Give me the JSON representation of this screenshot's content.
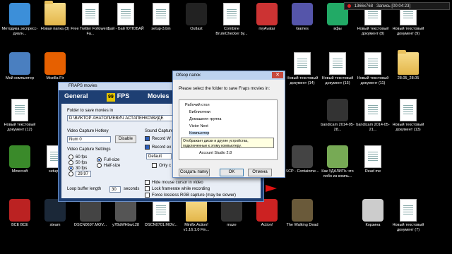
{
  "recorder": {
    "fps": "1366x768",
    "status": "Запись [00:04:23]"
  },
  "desktop_icons": [
    {
      "label": "Методика экспресс-диагн...",
      "kind": "app",
      "color": "#3c8fd9"
    },
    {
      "label": "Новая папка (3)",
      "kind": "folder"
    },
    {
      "label": "Free Twitter Followers, Fa...",
      "kind": "doc"
    },
    {
      "label": "Бай - Бай ЮТЮБАЙ",
      "kind": "doc"
    },
    {
      "label": "setup-3.bin",
      "kind": "doc"
    },
    {
      "label": "Outlast",
      "kind": "app",
      "color": "#222"
    },
    {
      "label": "Combine BruteChecker by...",
      "kind": "doc"
    },
    {
      "label": "myAvatar",
      "kind": "app",
      "color": "#c33"
    },
    {
      "label": "Games",
      "kind": "app",
      "color": "#55a"
    },
    {
      "label": "вфы",
      "kind": "app",
      "color": "#2a6"
    },
    {
      "label": "Новый текстовый документ (8)",
      "kind": "doc"
    },
    {
      "label": "Новый текстовый документ (9)",
      "kind": "doc"
    },
    {
      "label": "Мой компьютер",
      "kind": "app",
      "color": "#4a7fc0"
    },
    {
      "label": "Mozilla Fir",
      "kind": "app",
      "color": "#e66000"
    },
    {
      "label": "Новый текстовый документ (14)",
      "kind": "doc"
    },
    {
      "label": "Новый текстовый документ (15)",
      "kind": "doc"
    },
    {
      "label": "Новый текстовый документ (11)",
      "kind": "doc"
    },
    {
      "label": "28.05_28.05",
      "kind": "folder"
    },
    {
      "label": "Новый текстовый документ (12)",
      "kind": "doc"
    },
    {
      "label": "bandicam 2014-05-28...",
      "kind": "app",
      "color": "#333"
    },
    {
      "label": "bandicam 2014-05-21...",
      "kind": "doc"
    },
    {
      "label": "Новый текстовый документ (13)",
      "kind": "doc"
    },
    {
      "label": "Minecraft",
      "kind": "app",
      "color": "#3a8a2a"
    },
    {
      "label": "setup.b",
      "kind": "doc"
    },
    {
      "label": "SCP - Containme...",
      "kind": "app",
      "color": "#444"
    },
    {
      "label": "Как УДАЛИТЬ что либо из компь...",
      "kind": "app",
      "color": "#7a5"
    },
    {
      "label": "Read me",
      "kind": "doc"
    },
    {
      "label": "ВСЕ ВСЕ",
      "kind": "app",
      "color": "#b22"
    },
    {
      "label": "steam",
      "kind": "app",
      "color": "#1b2838"
    },
    {
      "label": "DSCN0697.MOV...",
      "kind": "app",
      "color": "#444"
    },
    {
      "label": "y7BdWHbwL28",
      "kind": "app",
      "color": "#555"
    },
    {
      "label": "DSCN0701.MOV...",
      "kind": "doc"
    },
    {
      "label": "Minifix Action! v1.16.1.0 Fin...",
      "kind": "folder"
    },
    {
      "label": "maze",
      "kind": "app",
      "color": "#333"
    },
    {
      "label": "Action!",
      "kind": "app",
      "color": "#c22"
    },
    {
      "label": "The Walking Dead",
      "kind": "app",
      "color": "#6a5a3a"
    },
    {
      "label": "Корзина",
      "kind": "app",
      "color": "#ccc"
    },
    {
      "label": "Новый текстовый документ (7)",
      "kind": "doc"
    }
  ],
  "fraps": {
    "title": "FRAPS movies",
    "tabs": {
      "general": "General",
      "fps_badge": "99",
      "fps": "FPS",
      "movies": "Movies"
    },
    "folder_label": "Folder to save movies in",
    "folder_path": "D:\\ВИКТОР АНАТОЛИЕВИЧ АСТАПЕНКО\\ВИДЕ",
    "hotkey_label": "Video Capture Hotkey",
    "hotkey_value": "Num 0",
    "disable_label": "Disable",
    "settings_label": "Video Capture Settings",
    "fps_options": [
      "60 fps",
      "50 fps",
      "30 fps"
    ],
    "custom_fps": "29.97",
    "size_options": [
      "Full-size",
      "Half-size"
    ],
    "loop_label": "Loop buffer length",
    "loop_value": "30",
    "loop_unit": "seconds",
    "sound_label": "Sound Capture",
    "record_w": "Record W",
    "record_ex": "Record ex",
    "default_value": "Default",
    "only_label": "Only c",
    "hide_cursor": "Hide mouse cursor in video",
    "lock_frame": "Lock framerate while recording",
    "force_rgb": "Force lossless RGB capture (may be slower)"
  },
  "dialog": {
    "title": "Обзор папок",
    "prompt": "Please select the folder to save Fraps movies in:",
    "tree": [
      "Рабочий стол",
      "Библиотеки",
      "Домашняя группа",
      "Victor Next",
      "Компьютер",
      "Ак",
      "Account Studio 2.8"
    ],
    "new_folder": "Создать папку",
    "ok": "OK",
    "cancel": "Отмена",
    "tooltip": "Отображает диски и другие устройства, подключенные к этому компьютеру."
  }
}
